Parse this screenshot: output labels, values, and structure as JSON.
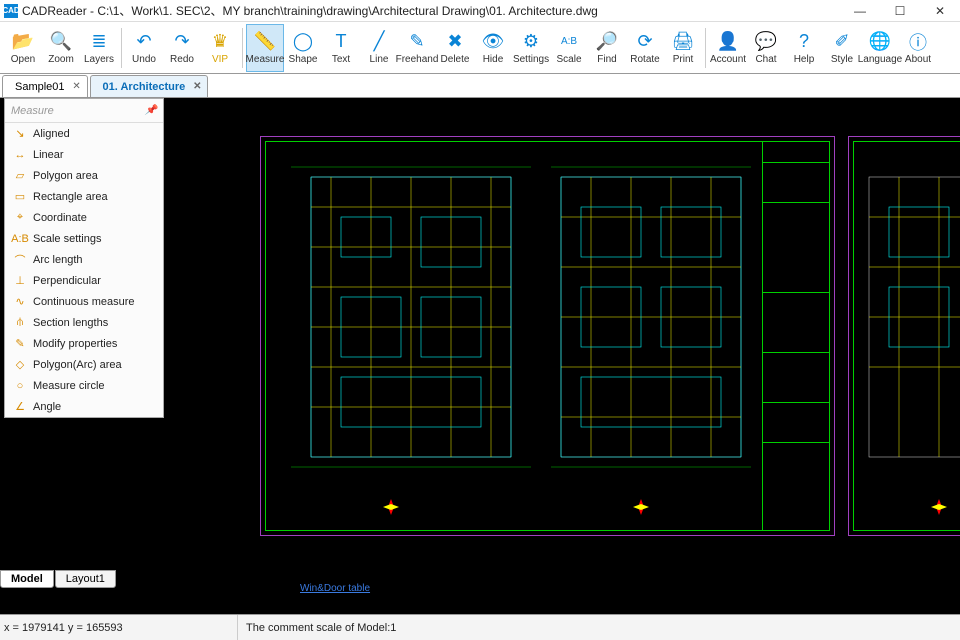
{
  "window": {
    "app_badge": "CAD",
    "title": "CADReader - C:\\1、Work\\1. SEC\\2、MY branch\\training\\drawing\\Architectural Drawing\\01. Architecture.dwg",
    "min": "—",
    "max": "☐",
    "close": "✕"
  },
  "toolbar": {
    "open": "Open",
    "zoom": "Zoom",
    "layers": "Layers",
    "undo": "Undo",
    "redo": "Redo",
    "vip": "VIP",
    "measure": "Measure",
    "shape": "Shape",
    "text": "Text",
    "line": "Line",
    "freehand": "Freehand",
    "delete": "Delete",
    "hide": "Hide",
    "settings": "Settings",
    "scale": "Scale",
    "find": "Find",
    "rotate": "Rotate",
    "print": "Print",
    "account": "Account",
    "chat": "Chat",
    "help": "Help",
    "style": "Style",
    "language": "Language",
    "about": "About"
  },
  "tabs": {
    "items": [
      {
        "label": "Sample01",
        "active": false
      },
      {
        "label": "01. Architecture",
        "active": true
      }
    ]
  },
  "measure_panel": {
    "header": "Measure",
    "items": [
      {
        "icon": "↘",
        "label": "Aligned"
      },
      {
        "icon": "↔",
        "label": "Linear"
      },
      {
        "icon": "▱",
        "label": "Polygon area"
      },
      {
        "icon": "▭",
        "label": "Rectangle area"
      },
      {
        "icon": "⌖",
        "label": "Coordinate"
      },
      {
        "icon": "A:B",
        "label": "Scale settings"
      },
      {
        "icon": "⌒",
        "label": "Arc length"
      },
      {
        "icon": "⊥",
        "label": "Perpendicular"
      },
      {
        "icon": "∿",
        "label": "Continuous measure"
      },
      {
        "icon": "⫛",
        "label": "Section lengths"
      },
      {
        "icon": "✎",
        "label": "Modify properties"
      },
      {
        "icon": "◇",
        "label": "Polygon(Arc) area"
      },
      {
        "icon": "○",
        "label": "Measure circle"
      },
      {
        "icon": "∠",
        "label": "Angle"
      }
    ]
  },
  "bottom_tabs": {
    "model": "Model",
    "layout1": "Layout1"
  },
  "status": {
    "coords": "x = 1979141 y = 165593",
    "scale": "The comment scale of Model:1"
  },
  "canvas": {
    "link_text": "Win&Door table"
  }
}
